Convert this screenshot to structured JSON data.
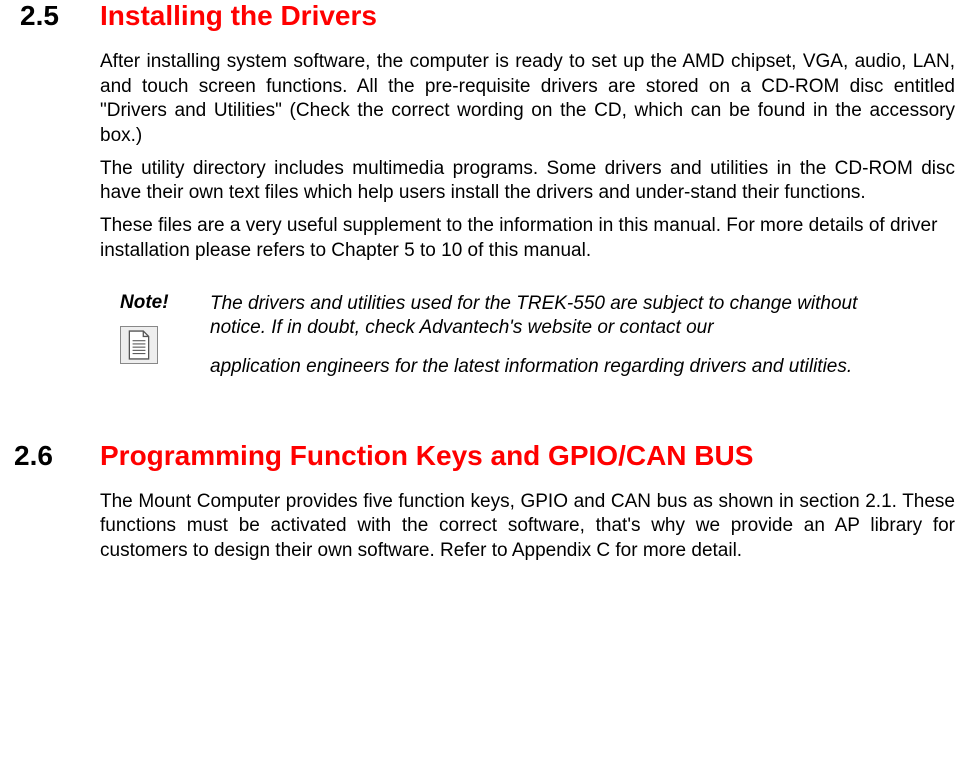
{
  "section1": {
    "number": "2.5",
    "title": "Installing the Drivers",
    "p1": "After installing system software,  the computer is ready to set  up the AMD chipset, VGA, audio, LAN, and touch screen functions. All the pre-requisite drivers are stored on a CD-ROM disc entitled \"Drivers and Utilities\" (Check the correct wording on the CD, which can be found in the accessory box.)",
    "p2": "The utility directory includes multimedia programs. Some drivers and utilities in the CD-ROM disc have their own text files which help users install the drivers and under-stand their functions.",
    "p3": "These files are a very useful supplement to the information in this manual. For more details of driver installation please refers to Chapter 5 to 10 of this manual.",
    "note_label": "Note!",
    "note_text1": "The drivers and utilities used for the TREK-550 are subject to change without notice. If in doubt, check Advantech's website or contact our",
    "note_text2": "application engineers for the latest information regarding drivers and utilities."
  },
  "section2": {
    "number": "2.6",
    "title": "Programming Function Keys and GPIO/CAN BUS",
    "p1": "The Mount Computer provides five function keys, GPIO and CAN bus as shown in section 2.1. These functions must be activated with the correct software, that's why we provide an AP library for customers to design their own software. Refer to Appendix C for more detail."
  }
}
